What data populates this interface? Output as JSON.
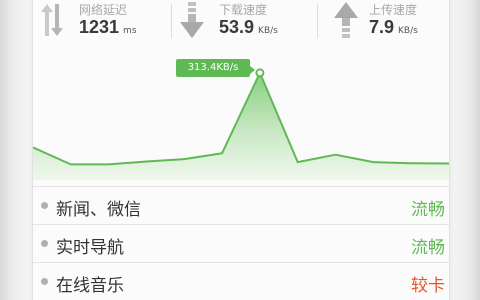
{
  "stats": {
    "latency": {
      "label": "网络延迟",
      "value": "1231",
      "unit": "ms",
      "icon": "updown-arrows-icon"
    },
    "download": {
      "label": "下载速度",
      "value": "53.9",
      "unit": "KB/s",
      "icon": "download-arrow-icon"
    },
    "upload": {
      "label": "上传速度",
      "value": "7.9",
      "unit": "KB/s",
      "icon": "upload-arrow-icon"
    }
  },
  "chart_data": {
    "type": "area",
    "peak_label": "313.4KB/s",
    "values": [
      60,
      2,
      2,
      12,
      20,
      40,
      313.4,
      10,
      35,
      10,
      6,
      5
    ],
    "ylim": [
      0,
      330
    ],
    "color": "#5fb953"
  },
  "apps": [
    {
      "name": "新闻、微信",
      "status": "流畅",
      "color": "#5fb953"
    },
    {
      "name": "实时导航",
      "status": "流畅",
      "color": "#5fb953"
    },
    {
      "name": "在线音乐",
      "status": "较卡",
      "color": "#e8542e"
    }
  ]
}
